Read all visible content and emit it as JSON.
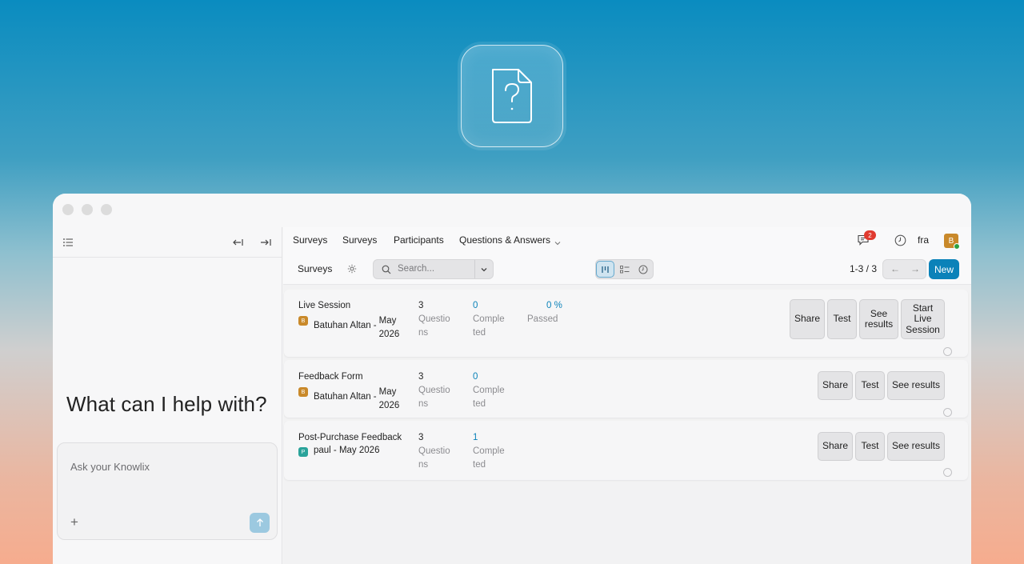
{
  "sidebar": {
    "help_title": "What can I help with?",
    "ask_placeholder": "Ask your Knowlix"
  },
  "topnav": {
    "items": [
      "Surveys",
      "Surveys",
      "Participants",
      "Questions & Answers"
    ],
    "notification_count": "2",
    "language": "fra",
    "user_initial": "B"
  },
  "controls": {
    "breadcrumb": "Surveys",
    "search_placeholder": "Search...",
    "pager_text": "1-3 / 3",
    "new_label": "New"
  },
  "surveys": [
    {
      "name": "Live Session",
      "author_initial": "B",
      "author": "Batuhan Altan -",
      "date_line1": "May",
      "date_line2": "2026",
      "questions": "3",
      "questions_label_1": "Questio",
      "questions_label_2": "ns",
      "completed": "0",
      "completed_label_1": "Comple",
      "completed_label_2": "ted",
      "passed": "0 %",
      "passed_label": "Passed",
      "buttons": [
        "Share",
        "Test",
        "See results",
        "Start Live Session"
      ]
    },
    {
      "name": "Feedback Form",
      "author_initial": "B",
      "author": "Batuhan Altan -",
      "date_line1": "May",
      "date_line2": "2026",
      "questions": "3",
      "questions_label_1": "Questio",
      "questions_label_2": "ns",
      "completed": "0",
      "completed_label_1": "Comple",
      "completed_label_2": "ted",
      "buttons": [
        "Share",
        "Test",
        "See results"
      ]
    },
    {
      "name": "Post-Purchase Feedback",
      "author_initial": "P",
      "author": "paul - May 2026",
      "questions": "3",
      "questions_label_1": "Questio",
      "questions_label_2": "ns",
      "completed": "1",
      "completed_label_1": "Comple",
      "completed_label_2": "ted",
      "buttons": [
        "Share",
        "Test",
        "See results"
      ]
    }
  ],
  "colors": {
    "accent": "#0b82b9",
    "badge": "#e03a2f",
    "avatar_b": "#c9892a",
    "avatar_p": "#2aa39a",
    "online": "#2ea043"
  }
}
